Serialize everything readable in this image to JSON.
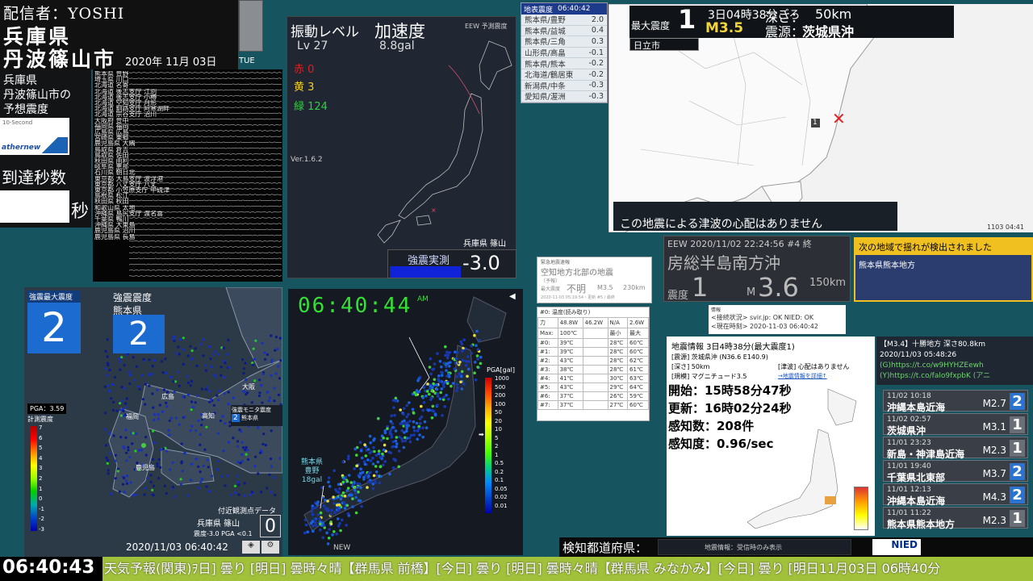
{
  "header": {
    "broadcaster": "配信者：YOSHI",
    "prefecture": "兵庫県",
    "city": "丹波篠山市",
    "date": "2020年 11月 03日",
    "weekday": "TUE"
  },
  "forecast": {
    "line1": "兵庫県",
    "line2": "丹波篠山市の",
    "line3": "予想震度",
    "widget_top": "10-Second",
    "widget_brand": "athernews",
    "arrival_label": "到達秒数",
    "arrival_unit": "秒"
  },
  "stations": [
    "熊本県 豊野",
    "埼玉県 川口",
    "北海道 名寄",
    "北海道 後志支庁 江別",
    "北海道 後志支庁 小樽",
    "北海道 空知支庁 月形",
    "北海道 釧路支庁 阿寒湖畔",
    "北海道 宗谷支庁 沼川",
    "大阪府 豊中",
    "福岡県 福岡",
    "広島県 広島",
    "宮崎県 東郷",
    "鹿児島県 大隅",
    "鳥取県 倉吉",
    "鳥取県 佐田",
    "秋田県 由利",
    "岐阜県 恵那",
    "石川県 朝日北",
    "東京都 大島支庁 波浮港",
    "東京都 八丈支庁 八丈",
    "東京都 小笠原支庁 中硫津",
    "島根県 松江",
    "秋田県 秋田",
    "和歌山県 太地",
    "沖縄県 島尻支庁 渡名喜",
    "千葉県 鴨川",
    "沖縄県 大東島",
    "鹿児島県 沼川",
    "鹿児島県 長島"
  ],
  "vibration": {
    "title": "振動レベル",
    "lv": "Lv 27",
    "accel_title": "加速度",
    "accel_value": "8.8gal",
    "red": "赤 0",
    "yellow": "黄 3",
    "green": "緑 124",
    "version": "Ver.1.6.2",
    "eew_label": "EEW 予測震度",
    "site": "兵庫県 篠山",
    "strong_label": "強震実測",
    "strong_value": "-3.0"
  },
  "intensity_list": {
    "title": "地表震度",
    "time": "06:40:42",
    "rows": [
      [
        "熊本県/豊野",
        "2.0"
      ],
      [
        "熊本県/益城",
        "0.4"
      ],
      [
        "熊本県/三角",
        "0.3"
      ],
      [
        "山形県/高畠",
        "-0.1"
      ],
      [
        "熊本県/熊本",
        "-0.2"
      ],
      [
        "北海道/鶴居東",
        "-0.2"
      ],
      [
        "新潟県/中条",
        "-0.3"
      ],
      [
        "愛知県/渥洲",
        "-0.3"
      ]
    ]
  },
  "nhk": {
    "max_label": "最大震度",
    "max_value": "1",
    "time": "3日04時38分ごろ",
    "mag": "M3.5",
    "depth_label": "深さ：",
    "depth_value": "50km",
    "epi_label": "震源：",
    "epi_value": "茨城県沖",
    "city": "日立市",
    "tsunami": "この地震による津波の心配はありません",
    "corner": "1103 04:41",
    "marker": "1"
  },
  "eew": {
    "header": "EEW  2020/11/02 22:24:56  #4 終",
    "region": "房総半島南方沖",
    "int_label": "震度",
    "int_value": "1",
    "mag_prefix": "M",
    "mag": "3.6",
    "depth": "150km"
  },
  "detect": {
    "title": "次の地域で揺れが検出されました",
    "region": "熊本県熊本地方"
  },
  "eew_small": {
    "line0": "緊急地震速報",
    "title": "空知地方北部の地震",
    "line2": "（予報）",
    "max_label": "最大震度",
    "max_value": "不明",
    "mag": "M3.5",
    "dist": "230km",
    "footer": "2020-11-03 05:19:54・更新 #5 / 最終"
  },
  "temps": {
    "title": "#0: 温度(読み取り)",
    "head": [
      "力",
      "48.8W",
      "46.2W",
      "N/A",
      "2.6W"
    ],
    "rows": [
      [
        "Max:",
        "100℃",
        "",
        "最小",
        "最大"
      ],
      [
        "#0:",
        "39℃",
        "",
        "28℃",
        "60℃"
      ],
      [
        "#1:",
        "39℃",
        "",
        "28℃",
        "60℃"
      ],
      [
        "#2:",
        "43℃",
        "",
        "28℃",
        "62℃"
      ],
      [
        "#3:",
        "38℃",
        "",
        "28℃",
        "61℃"
      ],
      [
        "#4:",
        "41℃",
        "",
        "30℃",
        "63℃"
      ],
      [
        "#5:",
        "43℃",
        "",
        "29℃",
        "64℃"
      ],
      [
        "#6:",
        "37℃",
        "",
        "26℃",
        "59℃"
      ],
      [
        "#7:",
        "37℃",
        "",
        "27℃",
        "60℃"
      ]
    ]
  },
  "conn": {
    "line1": "情報",
    "line2": "<接続状況>  svir.jp: OK   NIED: OK",
    "line3": "<現在時刻>  2020-11-03 06:40:42"
  },
  "quake_info": {
    "title": "地震情報  3日4時38分(最大震度1)",
    "line1": "[震源] 茨城県沖 (N36.6 E140.9)",
    "line2": "[深さ] 50km",
    "line2b": "[津波] 心配はありません",
    "line3": "[規模] マグニチュード3.5",
    "link": "→地震情報を詳細↑",
    "start": "開始：15時58分47秒",
    "update": "更新：16時02分24秒",
    "count": "感知数：208件",
    "rate": "感知度：0.96/sec"
  },
  "tweet": {
    "line1": "【M3.4】十勝地方 深さ80.8km",
    "line2": "2020/11/03 05:48:26",
    "line3": "(G)https://t.co/w9HYHZEewh",
    "line4": "(Y)https://t.co/falo9fxpbK (アニ"
  },
  "history": [
    {
      "dt": "11/02 10:18",
      "place": "沖縄本島近海",
      "mag": "M2.7",
      "shindo": "2",
      "color": "#2a74d0"
    },
    {
      "dt": "11/02 02:57",
      "place": "茨城県沖",
      "mag": "M3.1",
      "shindo": "1",
      "color": "#6a6f77"
    },
    {
      "dt": "11/01 23:23",
      "place": "新島・神津島近海",
      "mag": "M2.3",
      "shindo": "1",
      "color": "#6a6f77"
    },
    {
      "dt": "11/01 19:40",
      "place": "千葉県北東部",
      "mag": "M3.7",
      "shindo": "2",
      "color": "#2a74d0"
    },
    {
      "dt": "11/01 12:13",
      "place": "沖縄本島近海",
      "mag": "M4.3",
      "shindo": "2",
      "color": "#2a74d0"
    },
    {
      "dt": "11/01 11:22",
      "place": "熊本県熊本地方",
      "mag": "M2.3",
      "shindo": "1",
      "color": "#6a6f77"
    }
  ],
  "kmoni": {
    "max_label": "強震最大震度",
    "max_value": "2",
    "int_label": "強震震度",
    "pref": "熊本県",
    "pref_value": "2",
    "pga": "PGA：3.59",
    "scale_label": "計測震度",
    "scale": [
      "7",
      "6",
      "5",
      "4",
      "3",
      "2",
      "1",
      "0",
      "-1",
      "-2",
      "-3"
    ],
    "legend_title": "強震モニタ震度",
    "legend_val": "2",
    "legend_pref": "熊本県",
    "nearby": "付近観測点データ",
    "site": "兵庫県 篠山",
    "site_detail": "震度-3.0  PGA <0.1",
    "site_big": "0",
    "timestamp": "2020/11/03 06:40:42",
    "cities": [
      "広島",
      "高知",
      "福岡",
      "鹿児島",
      "大阪"
    ]
  },
  "pga_map": {
    "clock": "06:40:44",
    "am": "AM",
    "scale_title": "PGA[gal]",
    "scale": [
      "1000",
      "500",
      "200",
      "100",
      "50",
      "20",
      "10",
      "5",
      "2",
      "1",
      "0.5",
      "0.2",
      "0.1",
      "0.05",
      "0.02",
      "0.01"
    ],
    "callout_pref": "熊本県",
    "callout_site": "豊野",
    "callout_val": "18gal",
    "new": "NEW"
  },
  "bottom": {
    "pref_label": "検知都道府県：",
    "notice": "地震情報：受信時のみ表示",
    "brand": "NIED",
    "clock": "06:40:43",
    "ticker": "天気予報(関東)ｦ日] 曇り [明日] 曇時々晴【群馬県 前橋】[今日] 曇り [明日] 曇時々晴【群馬県 みなかみ】[今日] 曇り [明日11月03日 06時40分"
  }
}
